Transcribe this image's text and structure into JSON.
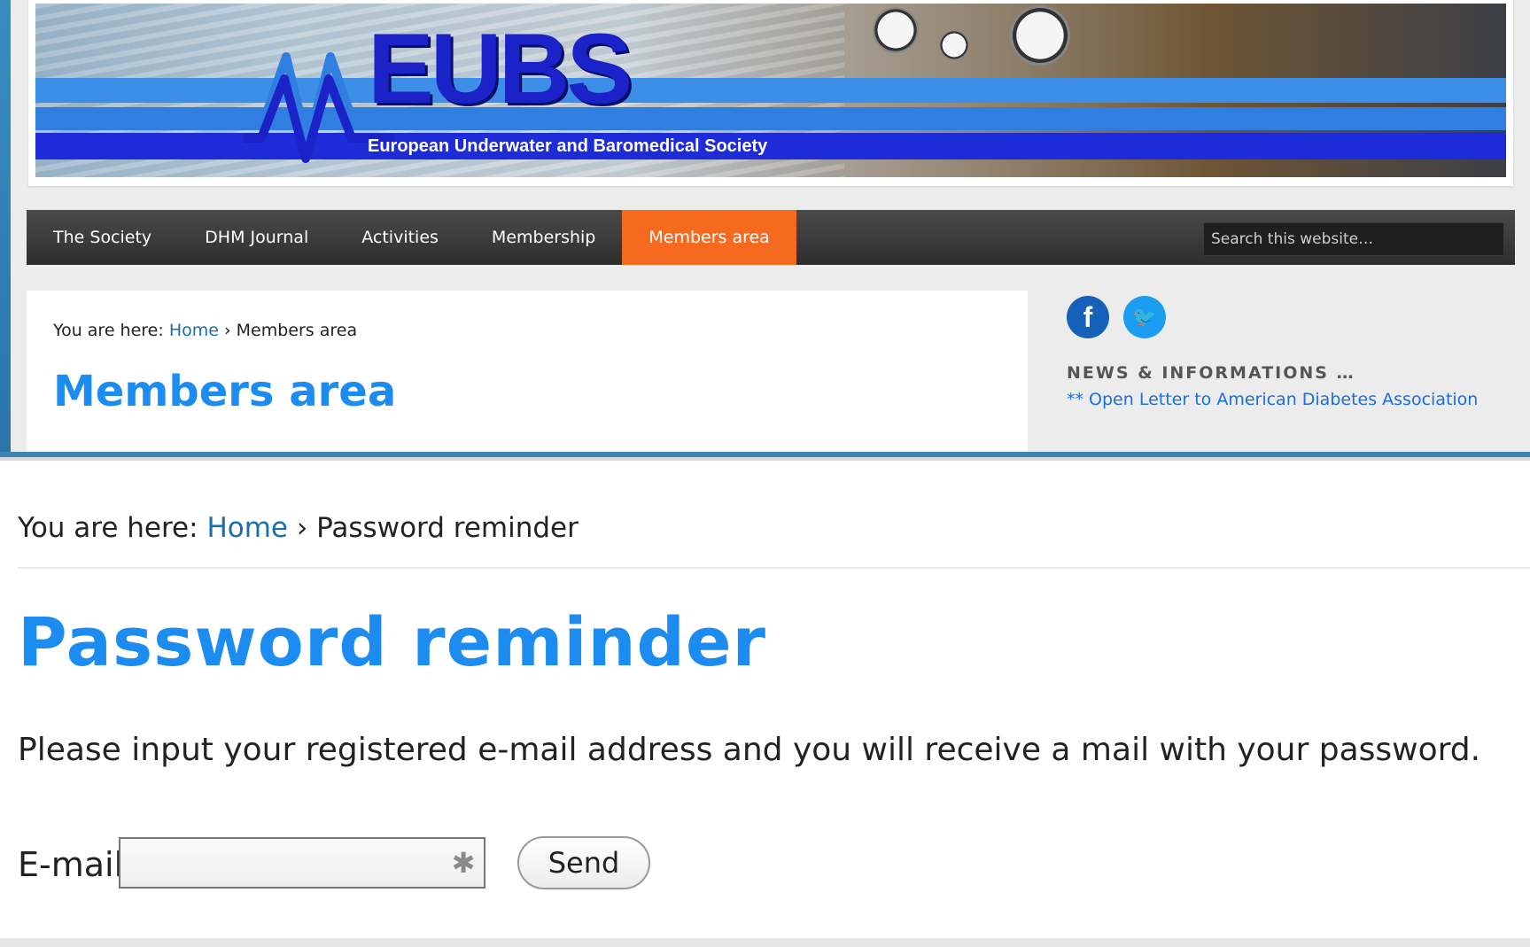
{
  "banner": {
    "logo_text": "EUBS",
    "subtitle": "European Underwater and Baromedical Society"
  },
  "nav": {
    "items": [
      {
        "label": "The Society"
      },
      {
        "label": "DHM Journal"
      },
      {
        "label": "Activities"
      },
      {
        "label": "Membership"
      },
      {
        "label": "Members area"
      }
    ],
    "active_item": "Members area",
    "active_color": "#f56a1e",
    "search_placeholder": "Search this website…"
  },
  "members_page": {
    "breadcrumb_prefix": "You are here:",
    "breadcrumb_home": "Home",
    "breadcrumb_separator": "›",
    "breadcrumb_current": "Members area",
    "title": "Members area"
  },
  "sidebar": {
    "social_icons": [
      "facebook-icon",
      "twitter-icon"
    ],
    "facebook_glyph": "f",
    "twitter_glyph": "🐦",
    "news_heading": "NEWS & INFORMATIONS …",
    "news_link": "** Open Letter to American Diabetes Association"
  },
  "password_page": {
    "breadcrumb_prefix": "You are here:",
    "breadcrumb_home": "Home",
    "breadcrumb_separator": "›",
    "breadcrumb_current": "Password reminder",
    "title": "Password reminder",
    "instructions": "Please input your registered e-mail address and you will receive a mail with your password.",
    "email_label": "E-mail",
    "email_value": "",
    "send_label": "Send"
  },
  "colors": {
    "title_blue": "#1c8cf0",
    "link_blue": "#1a6fa8",
    "logo_blue": "#1a22c8"
  }
}
